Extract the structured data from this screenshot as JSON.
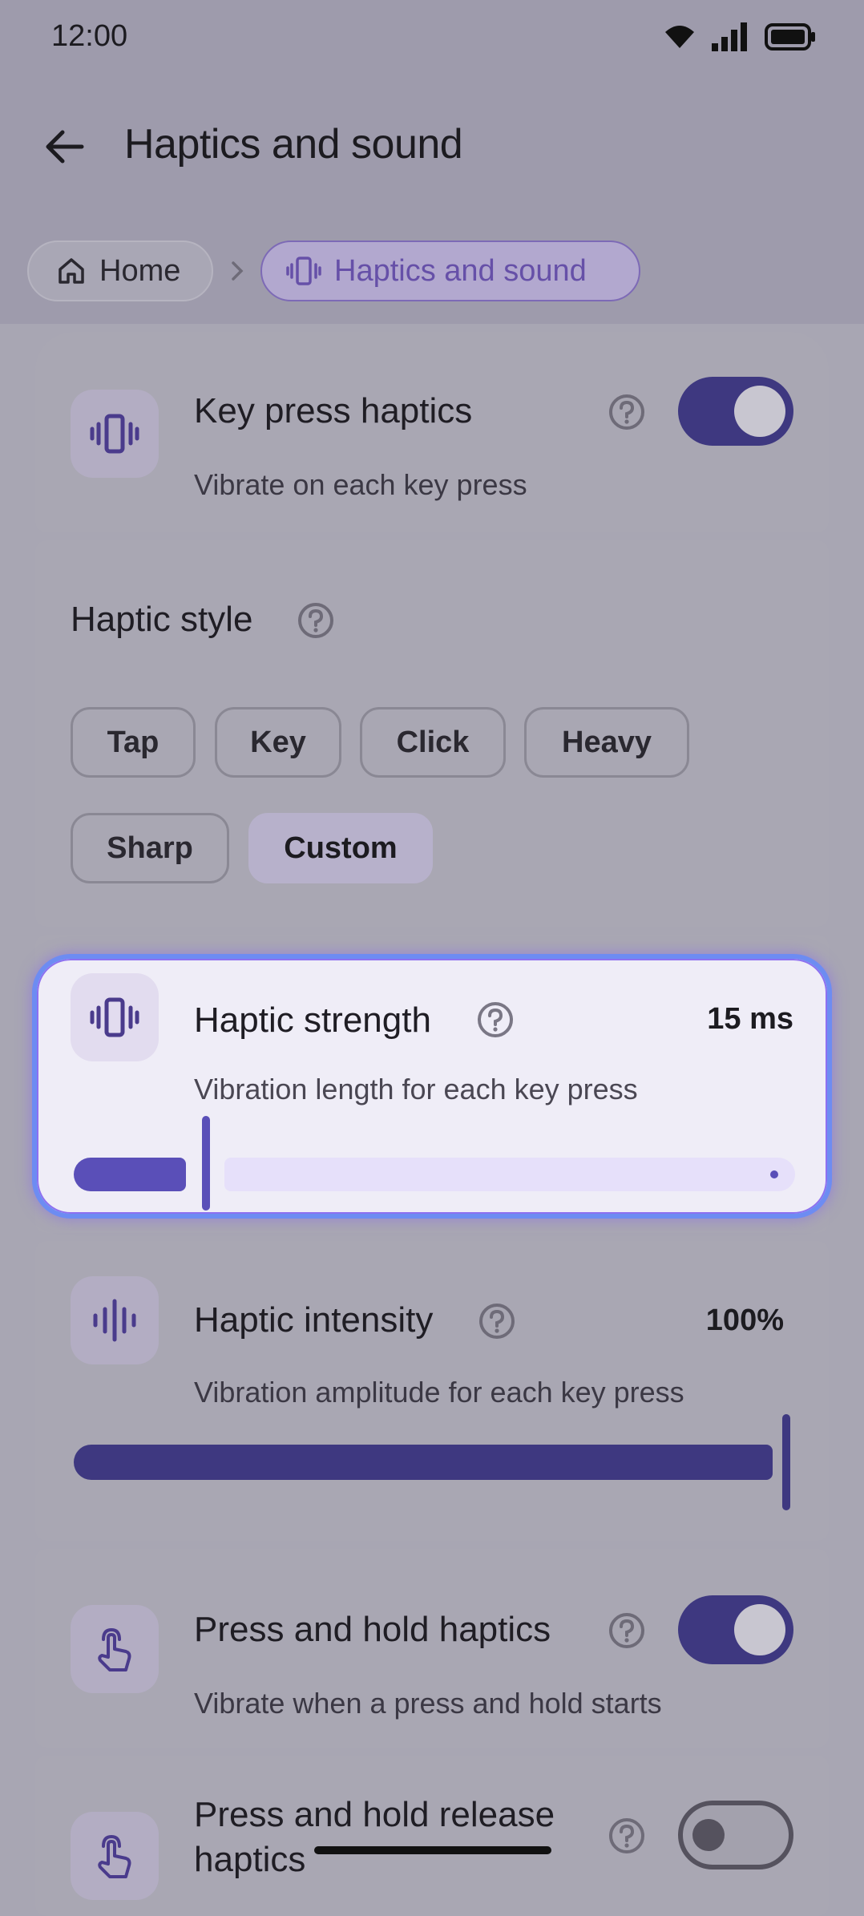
{
  "status_bar": {
    "time": "12:00"
  },
  "app_bar": {
    "title": "Haptics and sound"
  },
  "breadcrumb": {
    "home": "Home",
    "current": "Haptics and sound"
  },
  "key_press": {
    "label": "Key press haptics",
    "description": "Vibrate on each key press",
    "enabled": true
  },
  "haptic_style": {
    "label": "Haptic style",
    "options": [
      "Tap",
      "Key",
      "Click",
      "Heavy",
      "Sharp",
      "Custom"
    ],
    "selected": "Custom"
  },
  "strength": {
    "label": "Haptic strength",
    "description": "Vibration length for each key press",
    "value": "15 ms",
    "level": 0.17
  },
  "intensity": {
    "label": "Haptic intensity",
    "description": "Vibration amplitude for each key press",
    "value": "100%",
    "level": 1.0
  },
  "press_hold": {
    "label": "Press and hold haptics",
    "description": "Vibrate when a press and hold starts",
    "enabled": true
  },
  "press_hold_release": {
    "label_line1": "Press and hold release",
    "label_line2": "haptics",
    "enabled": false
  },
  "colors": {
    "accent": "#3e3880",
    "focus_border": "#6d8cf2",
    "slider_active": "#5a4fb8"
  }
}
